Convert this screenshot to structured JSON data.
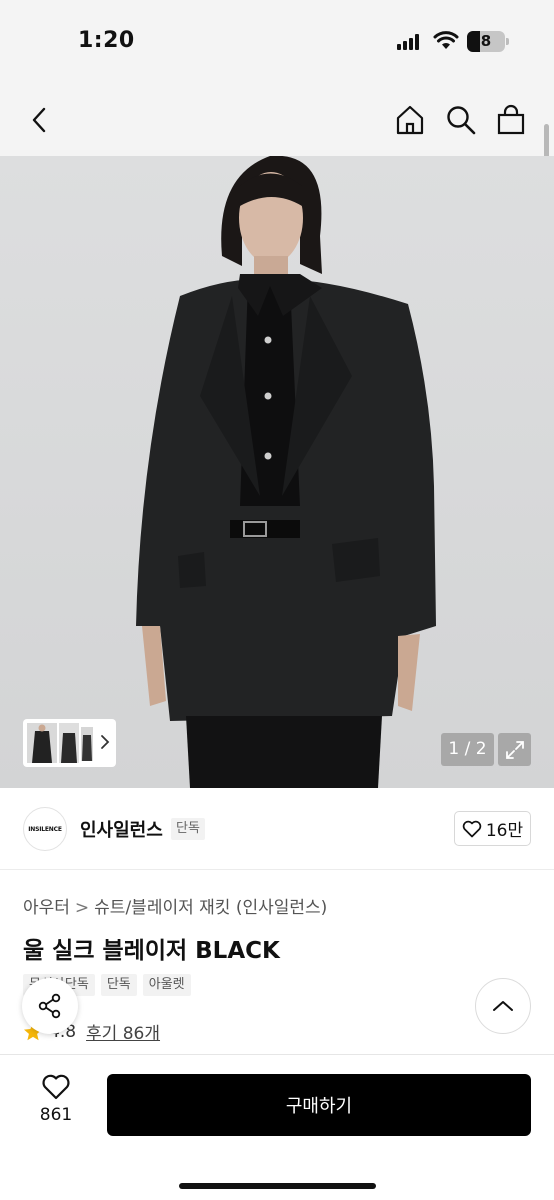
{
  "status_bar": {
    "time": "1:20",
    "battery": "8"
  },
  "nav": {
    "back_icon": "chevron-left-icon",
    "home_icon": "home-icon",
    "search_icon": "search-icon",
    "cart_icon": "shopping-bag-icon"
  },
  "gallery": {
    "counter": "1 / 2",
    "expand_icon": "expand-icon"
  },
  "brand": {
    "logo_text": "INSILENCE",
    "name": "인사일런스",
    "badge": "단독",
    "likes": "16만"
  },
  "breadcrumb": {
    "items": [
      "아우터",
      "슈트/블레이저 재킷 (인사일런스)"
    ],
    "separator": ">"
  },
  "product": {
    "title": "울 실크 블레이저 BLACK",
    "tags": [
      "무신사단독",
      "단독",
      "아울렛"
    ],
    "rating": "4.8",
    "reviews": "후기 86개"
  },
  "bottom_bar": {
    "wishlist_count": "861",
    "buy_label": "구매하기"
  }
}
